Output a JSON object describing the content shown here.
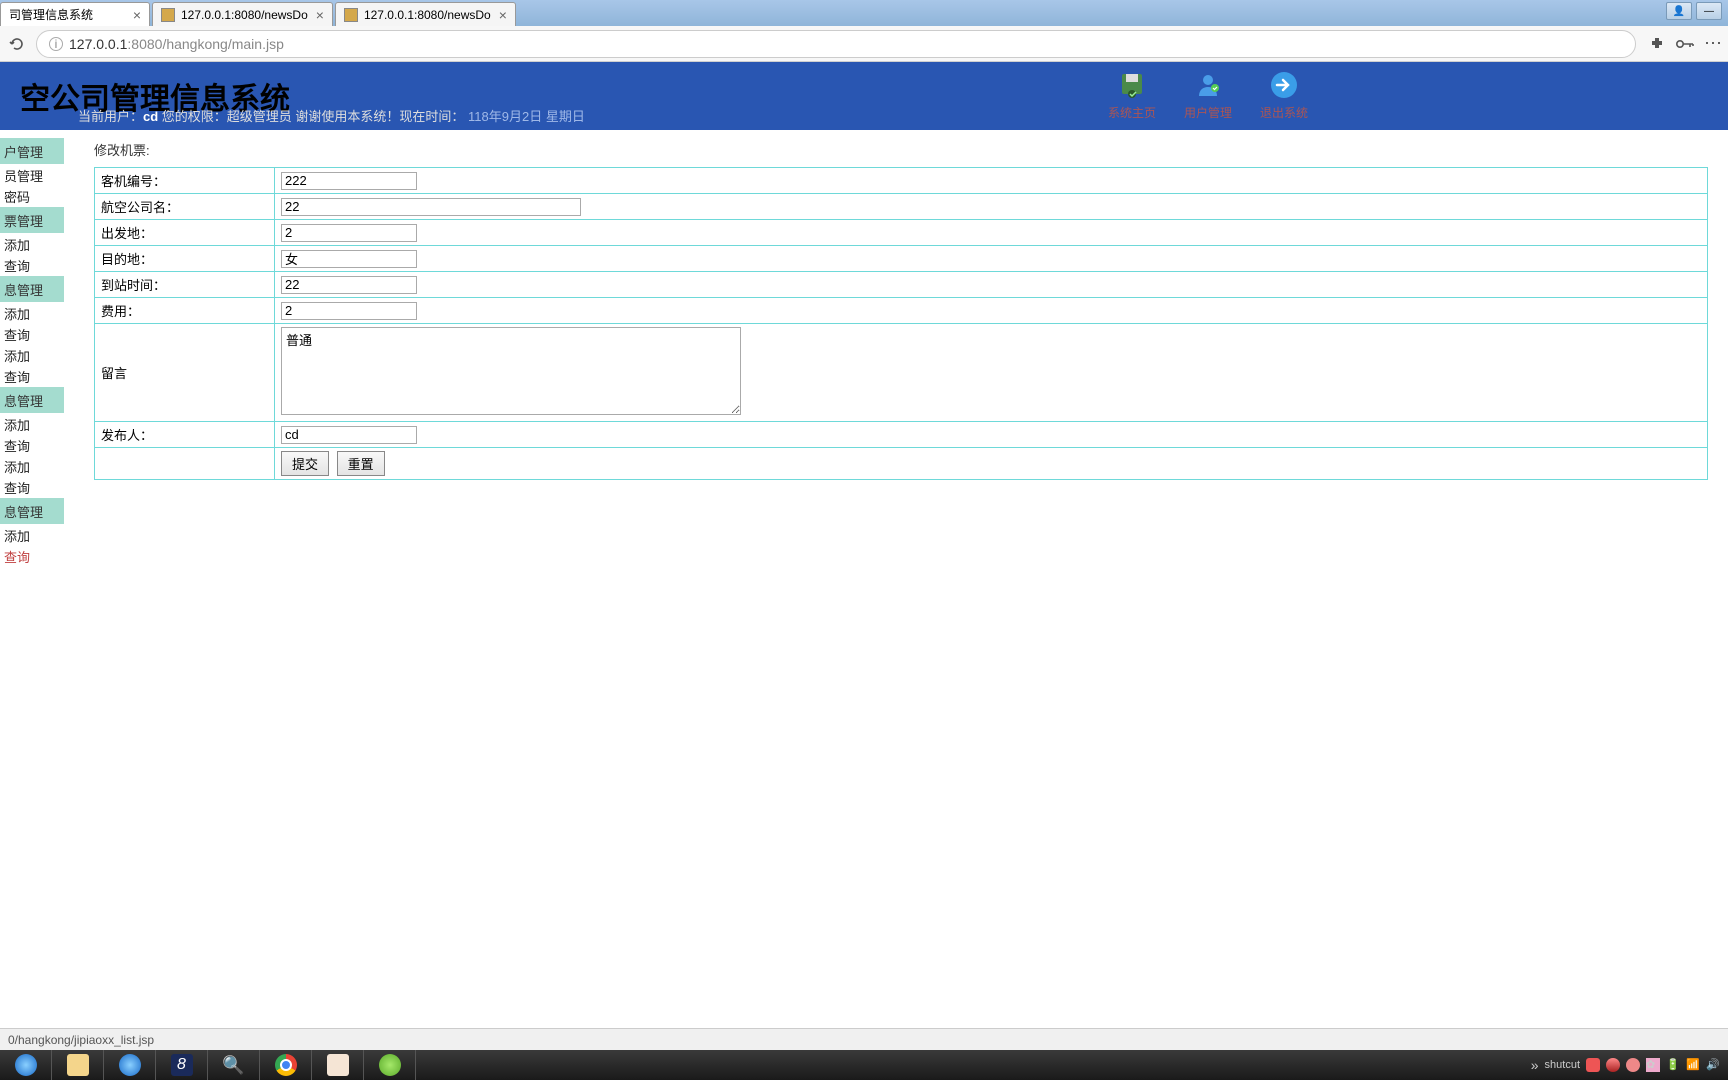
{
  "browser": {
    "tabs": [
      {
        "title": "司管理信息系统"
      },
      {
        "title": "127.0.0.1:8080/newsDo"
      },
      {
        "title": "127.0.0.1:8080/newsDo"
      }
    ],
    "url_host": "127.0.0.1",
    "url_port": ":8080",
    "url_path": "/hangkong/main.jsp"
  },
  "header": {
    "app_title": "空公司管理信息系统",
    "status_prefix": "当前用户：",
    "user": "cd",
    "status_mid": " 您的权限：超级管理员 谢谢使用本系统！现在时间：",
    "date": " 118年9月2日  星期日",
    "actions": {
      "home": "系统主页",
      "user": "用户管理",
      "exit": "退出系统"
    }
  },
  "sidebar": {
    "cat1": "户管理",
    "c1_items": [
      "员管理",
      "密码"
    ],
    "cat2": "票管理",
    "c2_items": [
      "添加",
      "查询"
    ],
    "cat3": "息管理",
    "c3_items": [
      "添加",
      "查询",
      "添加",
      "查询"
    ],
    "cat4": "息管理",
    "c4_items": [
      "添加",
      "查询",
      "添加",
      "查询"
    ],
    "cat5": "息管理",
    "c5_items": [
      "添加",
      "查询"
    ]
  },
  "page": {
    "title": "修改机票:",
    "labels": {
      "plane_no": "客机编号：",
      "airline": "航空公司名：",
      "departure": "出发地：",
      "destination": "目的地：",
      "arrive_time": "到站时间：",
      "fee": "费用：",
      "message": "留言",
      "publisher": "发布人："
    },
    "values": {
      "plane_no": "222",
      "airline": "22",
      "departure": "2",
      "destination": "女",
      "arrive_time": "22",
      "fee": "2",
      "message": "普通",
      "publisher": "cd"
    },
    "buttons": {
      "submit": "提交",
      "reset": "重置"
    }
  },
  "status_bar": "0/hangkong/jipiaoxx_list.jsp",
  "tray": {
    "label": "shutcut"
  }
}
